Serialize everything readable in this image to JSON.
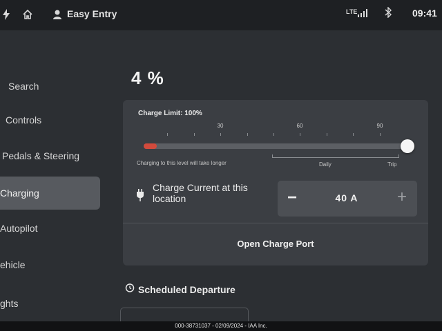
{
  "status_bar": {
    "profile_name": "Easy Entry",
    "network": "LTE",
    "time": "09:41",
    "icons": [
      "bolt-icon",
      "home-icon",
      "person-icon",
      "signal-icon",
      "bluetooth-icon"
    ]
  },
  "sidebar": {
    "items": [
      {
        "label": "Search",
        "active": false
      },
      {
        "label": "Controls",
        "active": false
      },
      {
        "label": "Pedals & Steering",
        "active": false
      },
      {
        "label": "Charging",
        "active": true
      },
      {
        "label": "Autopilot",
        "active": false
      },
      {
        "label": "ehicle",
        "active": false
      },
      {
        "label": "ghts",
        "active": false
      }
    ]
  },
  "charging": {
    "battery_level": "4 %",
    "limit_label": "Charge Limit: 100%",
    "limit_percent": 100,
    "current_level_percent": 4,
    "scale_ticks": [
      "30",
      "60",
      "90"
    ],
    "hint": "Charging to this level will take longer",
    "range_daily": "Daily",
    "range_trip": "Trip",
    "current_label": "Charge Current at this location",
    "current_value": "40 A",
    "minus_symbol": "−",
    "plus_symbol": "+",
    "open_port_label": "Open Charge Port",
    "scheduled_label": "Scheduled Departure"
  },
  "footer": {
    "watermark": "000-38731037 - 02/09/2024 - IAA Inc."
  },
  "colors": {
    "accent_red": "#d14a3c",
    "background": "#2c2f33",
    "card": "#3b3e43"
  }
}
